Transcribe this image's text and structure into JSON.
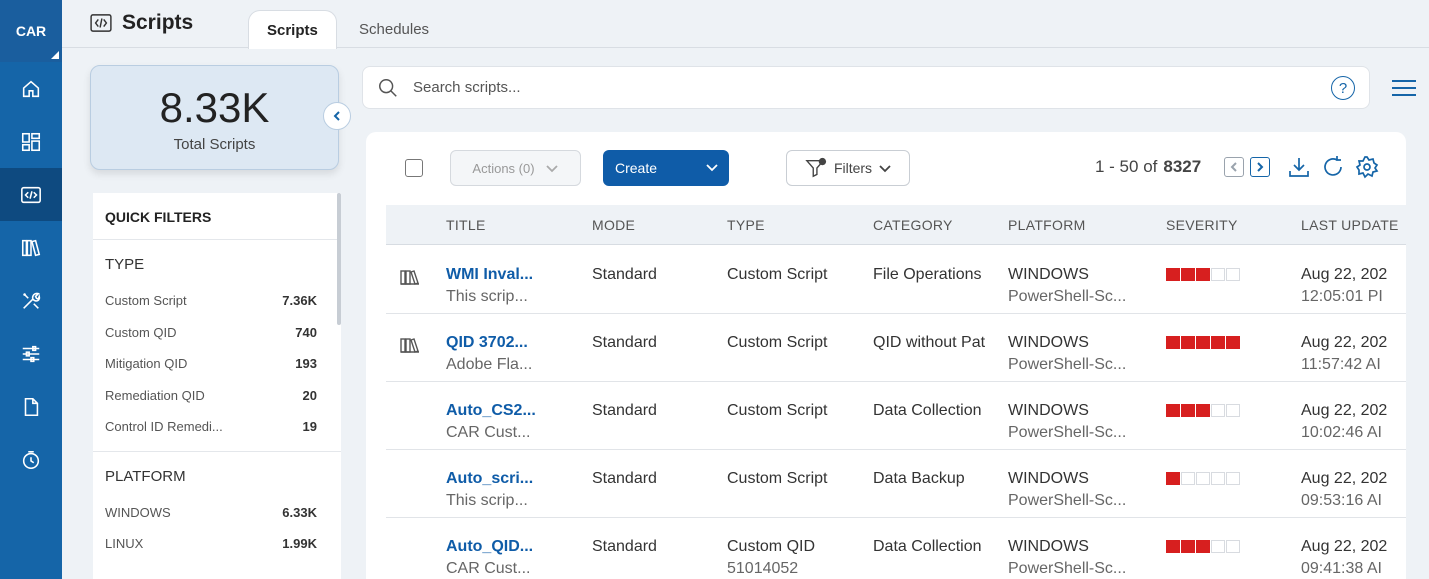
{
  "nav": {
    "app_label": "CAR",
    "items": [
      {
        "name": "home"
      },
      {
        "name": "dashboard"
      },
      {
        "name": "scripts"
      },
      {
        "name": "library"
      },
      {
        "name": "tools"
      },
      {
        "name": "settings"
      },
      {
        "name": "reports"
      },
      {
        "name": "history"
      }
    ],
    "active": "scripts"
  },
  "header": {
    "title": "Scripts",
    "tabs": [
      {
        "label": "Scripts",
        "active": true
      },
      {
        "label": "Schedules",
        "active": false
      }
    ]
  },
  "kpi": {
    "value": "8.33K",
    "label": "Total Scripts"
  },
  "quick_filters": {
    "title": "QUICK FILTERS",
    "groups": [
      {
        "title": "TYPE",
        "items": [
          {
            "label": "Custom Script",
            "count": "7.36K"
          },
          {
            "label": "Custom QID",
            "count": "740"
          },
          {
            "label": "Mitigation QID",
            "count": "193"
          },
          {
            "label": "Remediation QID",
            "count": "20"
          },
          {
            "label": "Control ID Remedi...",
            "count": "19"
          }
        ]
      },
      {
        "title": "PLATFORM",
        "items": [
          {
            "label": "WINDOWS",
            "count": "6.33K"
          },
          {
            "label": "LINUX",
            "count": "1.99K"
          }
        ]
      }
    ]
  },
  "search": {
    "placeholder": "Search scripts..."
  },
  "toolbar": {
    "actions_label": "Actions (0)",
    "create_label": "Create",
    "filters_label": "Filters",
    "pager_range": "1 - 50 of",
    "pager_total": "8327"
  },
  "table": {
    "columns": [
      "TITLE",
      "MODE",
      "TYPE",
      "CATEGORY",
      "PLATFORM",
      "SEVERITY",
      "LAST UPDATE"
    ],
    "rows": [
      {
        "has_icon": true,
        "title": "WMI Inval...",
        "title_sub": "This scrip...",
        "mode": "Standard",
        "type": "Custom Script",
        "type_sub": "",
        "category": "File Operations",
        "platform": "WINDOWS",
        "platform_sub": "PowerShell-Sc...",
        "severity": 3,
        "date": "Aug 22, 202",
        "time": "12:05:01 PI"
      },
      {
        "has_icon": true,
        "title": "QID 3702...",
        "title_sub": "Adobe Fla...",
        "mode": "Standard",
        "type": "Custom Script",
        "type_sub": "",
        "category": "QID without Pat",
        "platform": "WINDOWS",
        "platform_sub": "PowerShell-Sc...",
        "severity": 5,
        "date": "Aug 22, 202",
        "time": "11:57:42 AI"
      },
      {
        "has_icon": false,
        "title": "Auto_CS2...",
        "title_sub": "CAR Cust...",
        "mode": "Standard",
        "type": "Custom Script",
        "type_sub": "",
        "category": "Data Collection",
        "platform": "WINDOWS",
        "platform_sub": "PowerShell-Sc...",
        "severity": 3,
        "date": "Aug 22, 202",
        "time": "10:02:46 AI"
      },
      {
        "has_icon": false,
        "title": "Auto_scri...",
        "title_sub": "This scrip...",
        "mode": "Standard",
        "type": "Custom Script",
        "type_sub": "",
        "category": "Data Backup",
        "platform": "WINDOWS",
        "platform_sub": "PowerShell-Sc...",
        "severity": 1,
        "date": "Aug 22, 202",
        "time": "09:53:16 AI"
      },
      {
        "has_icon": false,
        "title": "Auto_QID...",
        "title_sub": "CAR Cust...",
        "mode": "Standard",
        "type": "Custom QID",
        "type_sub": "51014052",
        "category": "Data Collection",
        "platform": "WINDOWS",
        "platform_sub": "PowerShell-Sc...",
        "severity": 3,
        "date": "Aug 22, 202",
        "time": "09:41:38 AI"
      }
    ]
  },
  "colors": {
    "primary": "#1565a8",
    "severity": "#d71f1f"
  }
}
